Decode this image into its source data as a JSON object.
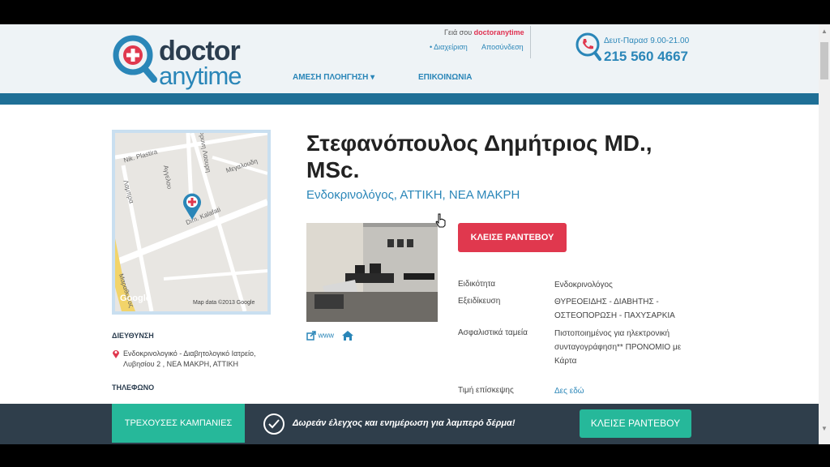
{
  "header": {
    "logo": {
      "word1": "doctor",
      "word2": "anytime"
    },
    "nav": {
      "quick_nav": "ΑΜΕΣΗ ΠΛΟΗΓΗΣΗ ▾",
      "contact": "ΕΠΙΚΟΙΝΩΝΙΑ"
    },
    "greeting_prefix": "Γειά σου ",
    "greeting_user": "doctoranytime",
    "manage": "• Διαχείριση",
    "logout": "Αποσύνδεση",
    "hours": "Δευτ-Παρασ  9.00-21.00",
    "phone": "215 560 4667"
  },
  "map": {
    "streets": [
      "Nik. Plastira",
      "Μεγαλουδη",
      "Λαμπρα",
      "Αγγελου",
      "Dim. Kalafati",
      "Φρυνη Λαουρη",
      "Μαραθωνος"
    ],
    "google": "Google",
    "attribution": "Map data ©2013 Google"
  },
  "address": {
    "title": "ΔΙΕΥΘΥΝΣΗ",
    "text": "Ενδοκρινολογικό - Διαβητολογικό Ιατρείο, Λυβησίου 2 , ΝΕΑ ΜΑΚΡΗ, ΑΤΤΙΚΗ"
  },
  "phone_title": "ΤΗΛΕΦΩΝΟ",
  "doctor": {
    "name": "Στεφανόπουλος Δημήτριος MD., MSc.",
    "specialty": "Ενδοκρινολόγος, ΑΤΤΙΚΗ, ΝΕΑ ΜΑΚΡΗ",
    "www_link": "www",
    "book_button": "ΚΛΕΙΣΕ ΡΑΝΤΕΒΟΥ",
    "details": [
      {
        "label": "Ειδικότητα",
        "value": "Ενδοκρινολόγος"
      },
      {
        "label": "Εξειδίκευση",
        "value": "ΘΥΡΕΟΕΙΔΗΣ - ΔΙΑΒΗΤΗΣ - ΟΣΤΕΟΠΟΡΩΣΗ - ΠΑΧΥΣΑΡΚΙΑ"
      },
      {
        "label": "Ασφαλιστικά ταμεία",
        "value": "Πιστοποιημένος για ηλεκτρονική συνταγογράφηση** ΠΡΟΝΟΜΙΟ με Κάρτα"
      },
      {
        "label": "Τιμή επίσκεψης",
        "value": "Δες εδώ"
      }
    ]
  },
  "bottom_bar": {
    "campaigns": "ΤΡΕΧΟΥΣΕΣ ΚΑΜΠΑΝΙΕΣ",
    "promo": "Δωρεάν έλεγχος και ενημέρωση για λαμπερό δέρμα!",
    "book": "ΚΛΕΙΣΕ ΡΑΝΤΕΒΟΥ"
  },
  "colors": {
    "brand_blue": "#2a86b8",
    "brand_dark": "#2b3d4f",
    "book_red": "#e0384e",
    "teal": "#26b89a",
    "bottom_bar": "#2f3e4b"
  }
}
